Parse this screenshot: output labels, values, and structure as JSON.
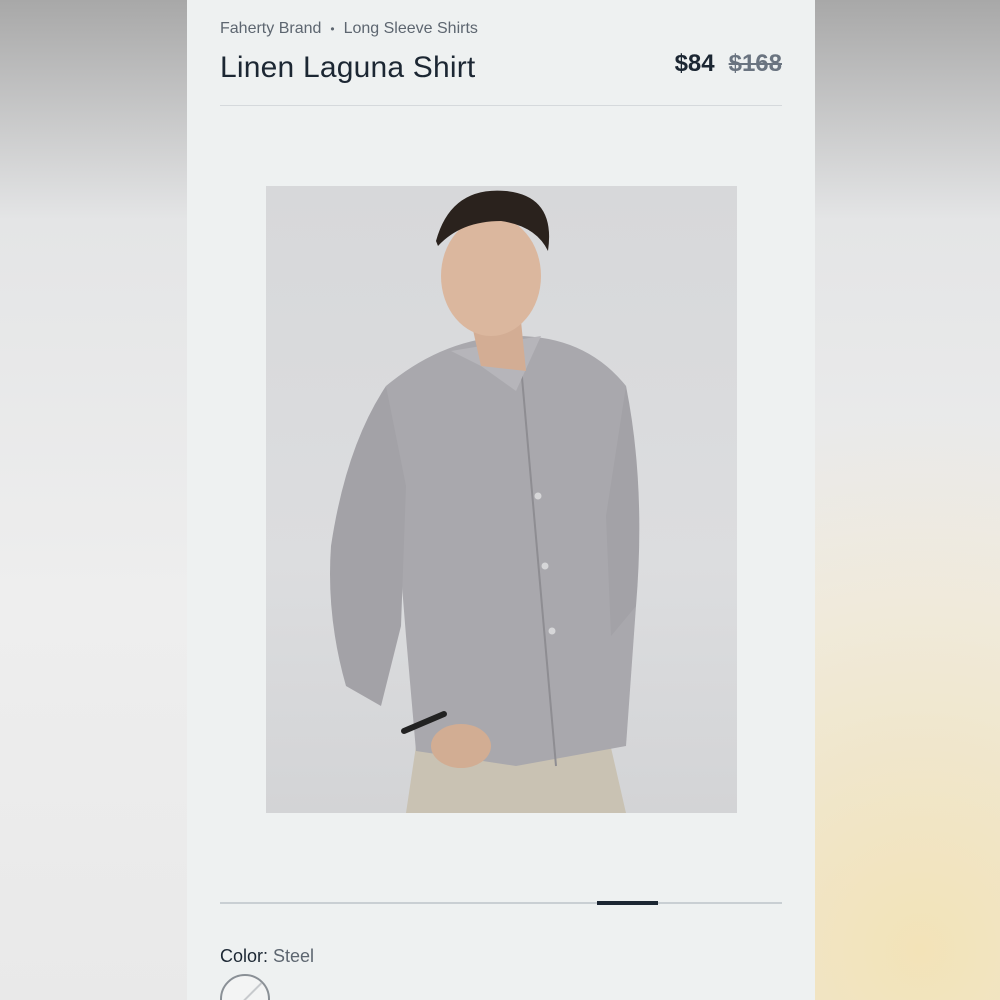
{
  "breadcrumb": {
    "brand": "Faherty Brand",
    "separator": "•",
    "category": "Long Sleeve Shirts"
  },
  "product": {
    "title": "Linen Laguna Shirt",
    "price": "$84",
    "original_price": "$168"
  },
  "gallery": {
    "image_icon": "product-photo",
    "progress_fraction_start": 0.67,
    "progress_fraction_end": 0.78
  },
  "color": {
    "label": "Color:",
    "value": "Steel",
    "swatch_color": "#f3f4f4"
  },
  "colors": {
    "accent": "#1c2733",
    "muted": "#5d6670",
    "card_bg": "#eef1f1"
  }
}
